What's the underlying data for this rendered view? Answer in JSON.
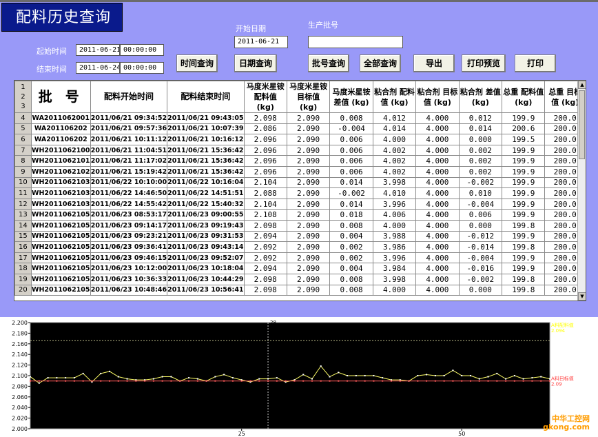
{
  "title": "配料历史查询",
  "filters": {
    "start_date_label": "开始日期",
    "start_date_value": "2011-06-21",
    "batch_label": "生产批号",
    "batch_value": "",
    "start_time_label": "起始时间",
    "start_time_date": "2011-06-21",
    "start_time_clock": "00:00:00",
    "end_time_label": "结束时间",
    "end_time_date": "2011-06-24",
    "end_time_clock": "00:00:00"
  },
  "buttons": {
    "time_query": "时间查询",
    "date_query": "日期查询",
    "batch_query": "批号查询",
    "all_query": "全部查询",
    "export": "导出",
    "print_preview": "打印预览",
    "print": "打印"
  },
  "table": {
    "row_numbers_header": [
      "1",
      "2",
      "3"
    ],
    "headers": [
      "批 号",
      "配料开始时间",
      "配料结束时间",
      "马度米星铵 配料值 (kg)",
      "马度米星铵 目标值 (kg)",
      "马度米星铵 差值 (kg)",
      "粘合剂 配料值 (kg)",
      "粘合剂 目标值 (kg)",
      "粘合剂 差值 (kg)",
      "总重 配料值 (kg)",
      "总重 目标值 (kg)"
    ],
    "rows": [
      [
        "4",
        "WA2011062001",
        "2011/06/21 09:34:52",
        "2011/06/21 09:43:05",
        "2.098",
        "2.090",
        "0.008",
        "4.012",
        "4.000",
        "0.012",
        "199.9",
        "200.0"
      ],
      [
        "5",
        "WA201106202",
        "2011/06/21 09:57:36",
        "2011/06/21 10:07:39",
        "2.086",
        "2.090",
        "-0.004",
        "4.014",
        "4.000",
        "0.014",
        "200.6",
        "200.0"
      ],
      [
        "6",
        "WA201106202",
        "2011/06/21 10:11:12",
        "2011/06/21 10:16:12",
        "2.096",
        "2.090",
        "0.006",
        "4.000",
        "4.000",
        "0.000",
        "199.5",
        "200.0"
      ],
      [
        "7",
        "WH2011062100",
        "2011/06/21 11:04:51",
        "2011/06/21 15:36:42",
        "2.096",
        "2.090",
        "0.006",
        "4.002",
        "4.000",
        "0.002",
        "199.9",
        "200.0"
      ],
      [
        "8",
        "WH2011062101",
        "2011/06/21 11:17:02",
        "2011/06/21 15:36:42",
        "2.096",
        "2.090",
        "0.006",
        "4.002",
        "4.000",
        "0.002",
        "199.9",
        "200.0"
      ],
      [
        "9",
        "WH2011062102",
        "2011/06/21 15:19:42",
        "2011/06/21 15:36:42",
        "2.096",
        "2.090",
        "0.006",
        "4.002",
        "4.000",
        "0.002",
        "199.9",
        "200.0"
      ],
      [
        "10",
        "WH2011062103",
        "2011/06/22 10:10:00",
        "2011/06/22 10:16:04",
        "2.104",
        "2.090",
        "0.014",
        "3.998",
        "4.000",
        "-0.002",
        "199.9",
        "200.0"
      ],
      [
        "11",
        "WH2011062103",
        "2011/06/22 14:46:50",
        "2011/06/22 14:51:51",
        "2.088",
        "2.090",
        "-0.002",
        "4.010",
        "4.000",
        "0.010",
        "199.9",
        "200.0"
      ],
      [
        "12",
        "WH2011062103",
        "2011/06/22 14:55:42",
        "2011/06/22 15:40:32",
        "2.104",
        "2.090",
        "0.014",
        "3.996",
        "4.000",
        "-0.004",
        "199.9",
        "200.0"
      ],
      [
        "13",
        "WH2011062105",
        "2011/06/23 08:53:17",
        "2011/06/23 09:00:55",
        "2.108",
        "2.090",
        "0.018",
        "4.006",
        "4.000",
        "0.006",
        "199.9",
        "200.0"
      ],
      [
        "14",
        "WH2011062105",
        "2011/06/23 09:14:17",
        "2011/06/23 09:19:43",
        "2.098",
        "2.090",
        "0.008",
        "4.000",
        "4.000",
        "0.000",
        "199.8",
        "200.0"
      ],
      [
        "15",
        "WH2011062105",
        "2011/06/23 09:23:21",
        "2011/06/23 09:31:53",
        "2.094",
        "2.090",
        "0.004",
        "3.988",
        "4.000",
        "-0.012",
        "199.9",
        "200.0"
      ],
      [
        "16",
        "WH2011062105",
        "2011/06/23 09:36:41",
        "2011/06/23 09:43:14",
        "2.092",
        "2.090",
        "0.002",
        "3.986",
        "4.000",
        "-0.014",
        "199.8",
        "200.0"
      ],
      [
        "17",
        "WH2011062105",
        "2011/06/23 09:46:15",
        "2011/06/23 09:52:07",
        "2.092",
        "2.090",
        "0.002",
        "3.996",
        "4.000",
        "-0.004",
        "199.9",
        "200.0"
      ],
      [
        "18",
        "WH2011062105",
        "2011/06/23 10:12:00",
        "2011/06/23 10:18:04",
        "2.094",
        "2.090",
        "0.004",
        "3.984",
        "4.000",
        "-0.016",
        "199.9",
        "200.0"
      ],
      [
        "19",
        "WH2011062105",
        "2011/06/23 10:36:33",
        "2011/06/23 10:44:29",
        "2.098",
        "2.090",
        "0.008",
        "3.998",
        "4.000",
        "-0.002",
        "199.8",
        "200.0"
      ],
      [
        "20",
        "WH2011062105",
        "2011/06/23 10:48:46",
        "2011/06/23 10:56:41",
        "2.098",
        "2.090",
        "0.008",
        "4.000",
        "4.000",
        "0.000",
        "199.8",
        "200.0"
      ]
    ]
  },
  "chart_data": {
    "type": "line",
    "ylim": [
      2.0,
      2.2
    ],
    "y_ticks": [
      "2.200",
      "2.180",
      "2.160",
      "2.140",
      "2.120",
      "2.100",
      "2.080",
      "2.060",
      "2.040",
      "2.020",
      "2.000"
    ],
    "x_ticks": [
      25,
      50
    ],
    "x_range": [
      1,
      60
    ],
    "series": [
      {
        "name": "A料配料值",
        "color": "#ffff66",
        "values": [
          2.098,
          2.086,
          2.096,
          2.096,
          2.096,
          2.096,
          2.104,
          2.088,
          2.104,
          2.108,
          2.098,
          2.094,
          2.092,
          2.092,
          2.094,
          2.098,
          2.098,
          2.09,
          2.096,
          2.094,
          2.09,
          2.098,
          2.102,
          2.096,
          2.092,
          2.088,
          2.094,
          2.094,
          2.096,
          2.088,
          2.092,
          2.102,
          2.094,
          2.118,
          2.098,
          2.106,
          2.1,
          2.1,
          2.1,
          2.1,
          2.096,
          2.092,
          2.092,
          2.09,
          2.1,
          2.102,
          2.1,
          2.1,
          2.11,
          2.1,
          2.1,
          2.094,
          2.098,
          2.104,
          2.094,
          2.1,
          2.094,
          2.096,
          2.098,
          2.094
        ]
      },
      {
        "name": "A料目标值",
        "color": "#ff5a5a",
        "values": [
          2.09,
          2.09,
          2.09,
          2.09,
          2.09,
          2.09,
          2.09,
          2.09,
          2.09,
          2.09,
          2.09,
          2.09,
          2.09,
          2.09,
          2.09,
          2.09,
          2.09,
          2.09,
          2.09,
          2.09,
          2.09,
          2.09,
          2.09,
          2.09,
          2.09,
          2.09,
          2.09,
          2.09,
          2.09,
          2.09,
          2.09,
          2.09,
          2.09,
          2.09,
          2.09,
          2.09,
          2.09,
          2.09,
          2.09,
          2.09,
          2.09,
          2.09,
          2.09,
          2.09,
          2.09,
          2.09,
          2.09,
          2.09,
          2.09,
          2.09,
          2.09,
          2.09,
          2.09,
          2.09,
          2.09,
          2.09,
          2.09,
          2.09,
          2.09,
          2.09
        ]
      }
    ],
    "cursor_label": "28",
    "cursor_x": 28,
    "legend_top_label": "A料配料值",
    "legend_top_value": "2.094",
    "legend_bottom_label": "A料目标值",
    "legend_bottom_value": "2.09",
    "watermark_line1": "中华工控网",
    "watermark_line2": "gkong.com"
  }
}
